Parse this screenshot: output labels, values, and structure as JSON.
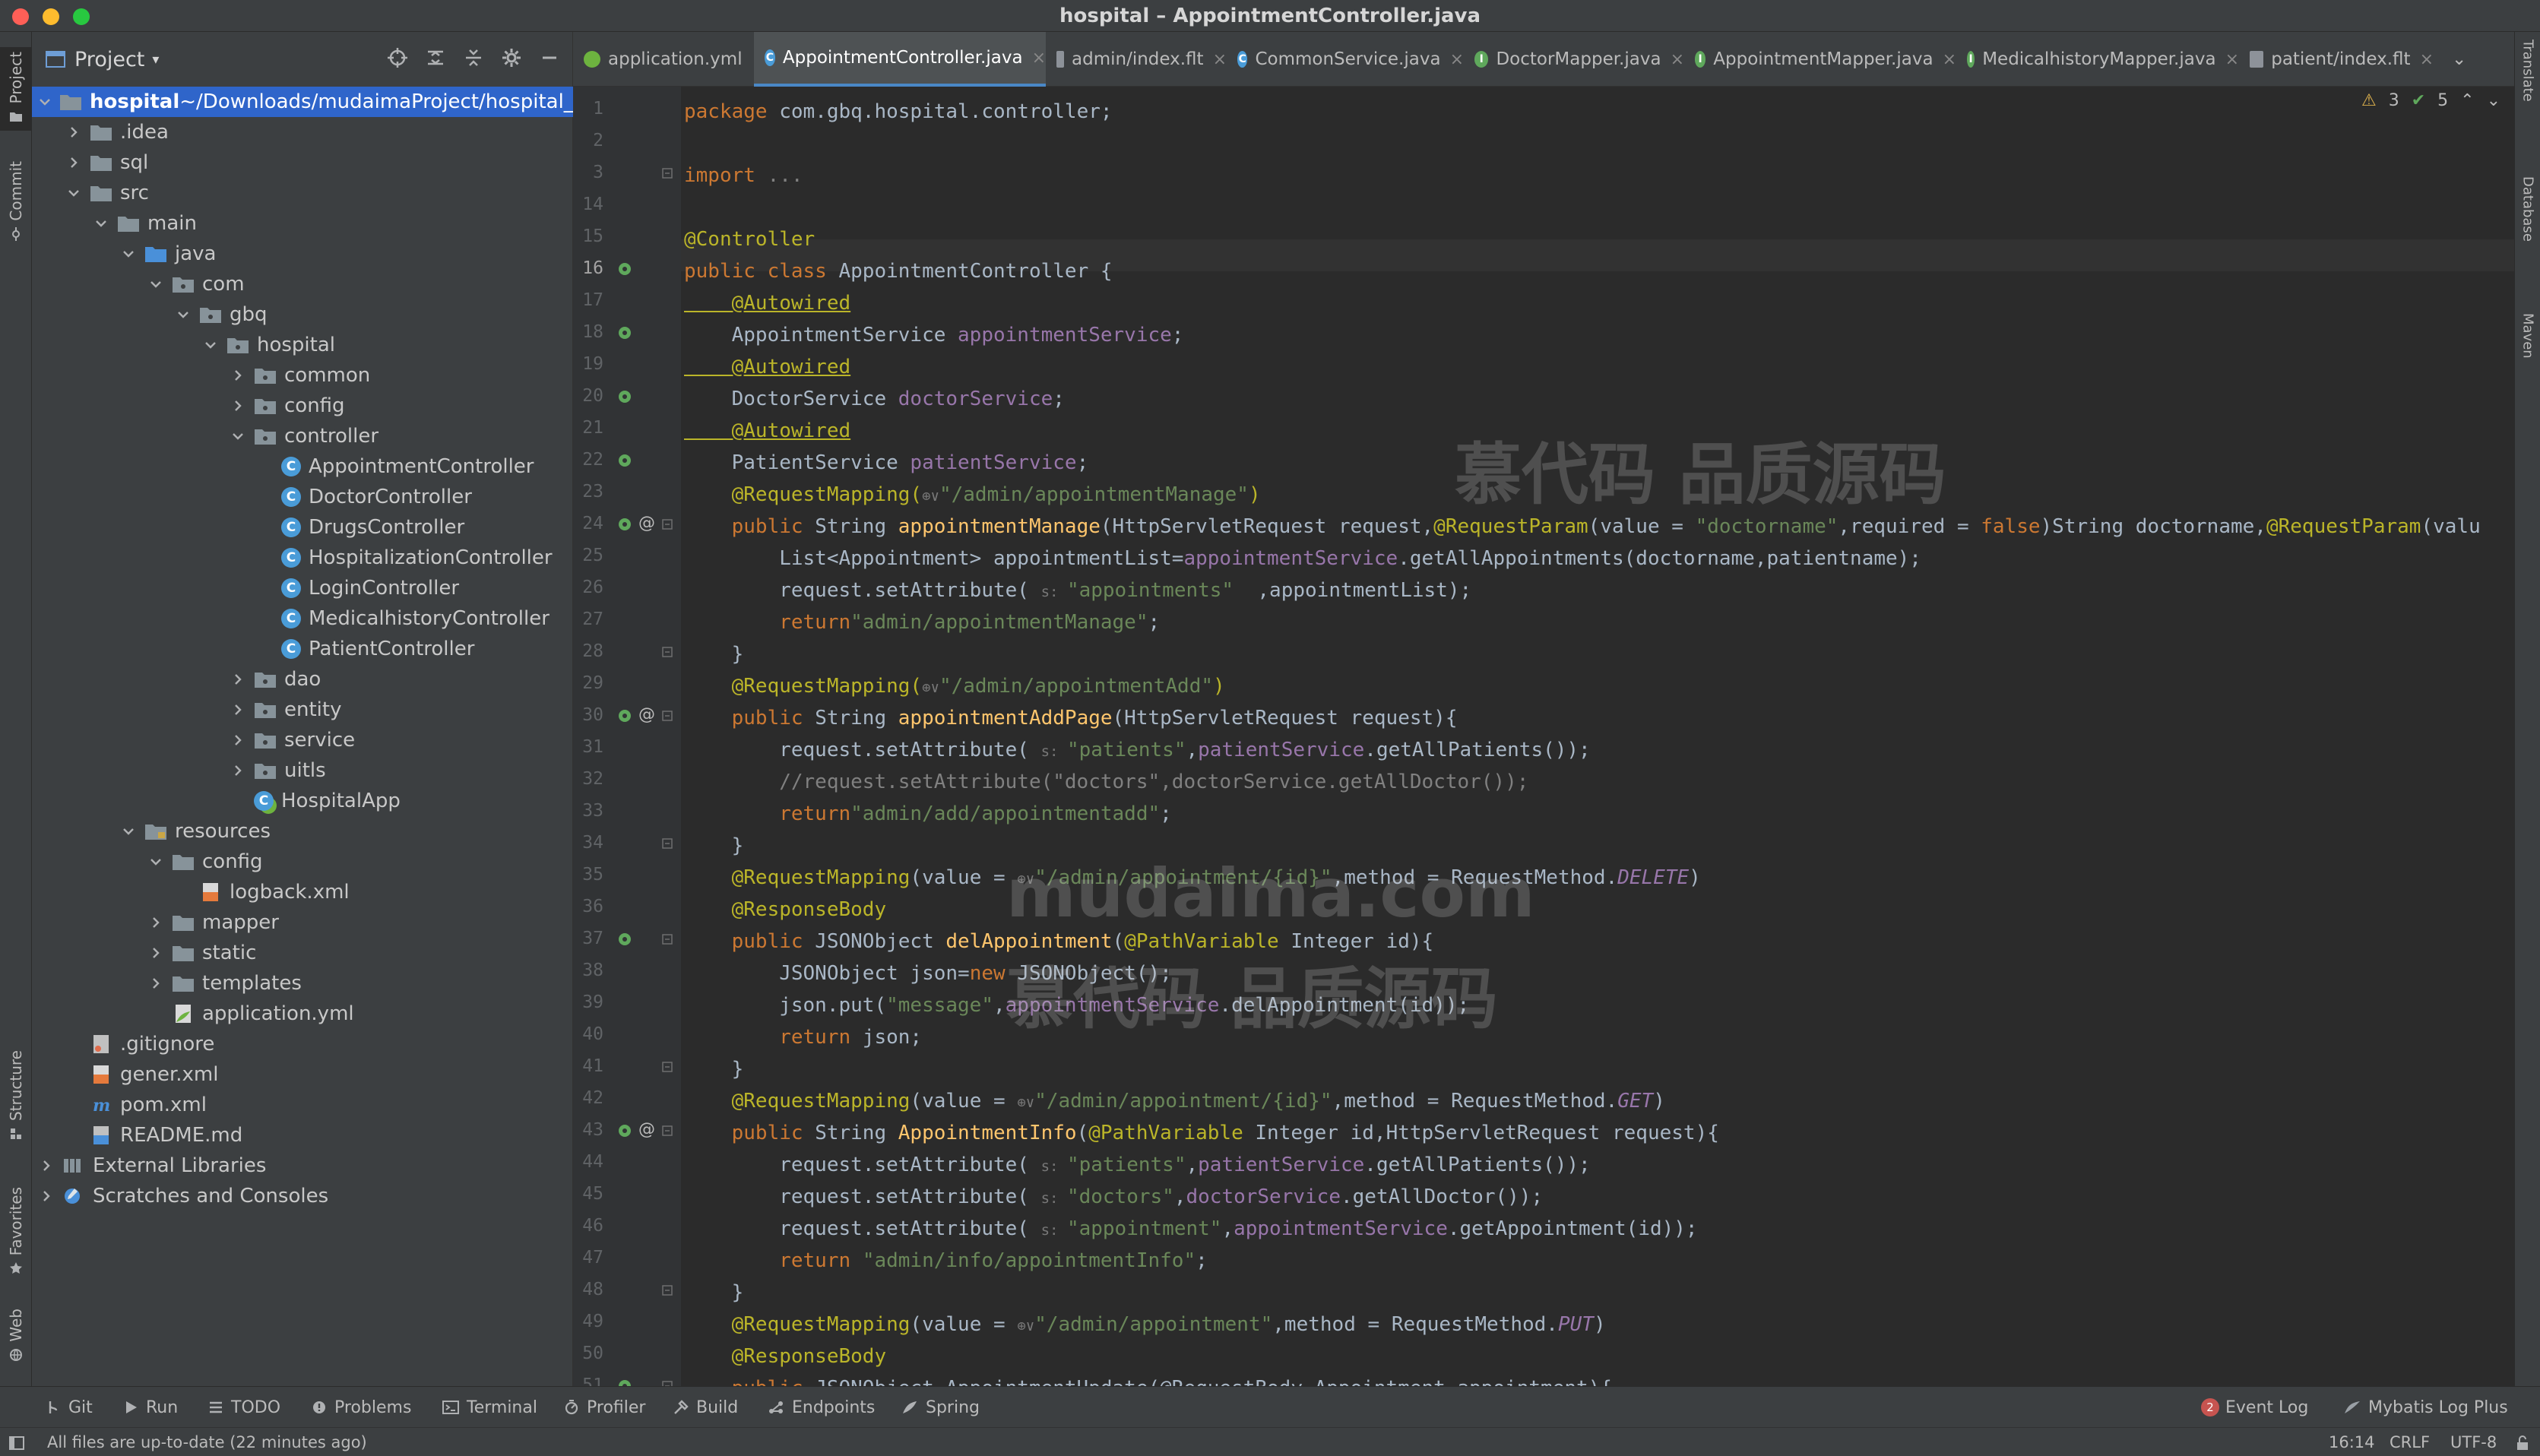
{
  "window": {
    "title": "hospital – AppointmentController.java"
  },
  "colors": {
    "accent": "#2f65ca",
    "keyword": "#cc7832",
    "annotation": "#bbb529",
    "string": "#6a8759",
    "method": "#ffc66d",
    "field": "#9876aa",
    "comment": "#808080"
  },
  "left_strip": {
    "project": "Project",
    "commit": "Commit",
    "structure": "Structure",
    "favorites": "Favorites",
    "web": "Web"
  },
  "right_strip": {
    "translate": "Translate",
    "database": "Database",
    "maven": "Maven"
  },
  "project_panel": {
    "title": "Project",
    "tree": [
      {
        "label": "hospital",
        "extra": " ~/Downloads/mudaimaProject/hospital_n",
        "icon": "folder-icon",
        "depth": 0,
        "state": "open",
        "selected": true
      },
      {
        "label": ".idea",
        "icon": "folder-icon",
        "depth": 1,
        "state": "closed"
      },
      {
        "label": "sql",
        "icon": "folder-icon",
        "depth": 1,
        "state": "closed"
      },
      {
        "label": "src",
        "icon": "folder-icon",
        "depth": 1,
        "state": "open"
      },
      {
        "label": "main",
        "icon": "folder-icon",
        "depth": 2,
        "state": "open"
      },
      {
        "label": "java",
        "icon": "source-folder-icon",
        "depth": 3,
        "state": "open"
      },
      {
        "label": "com",
        "icon": "package-icon",
        "depth": 4,
        "state": "open"
      },
      {
        "label": "gbq",
        "icon": "package-icon",
        "depth": 5,
        "state": "open"
      },
      {
        "label": "hospital",
        "icon": "package-icon",
        "depth": 6,
        "state": "open"
      },
      {
        "label": "common",
        "icon": "package-icon",
        "depth": 7,
        "state": "closed"
      },
      {
        "label": "config",
        "icon": "package-icon",
        "depth": 7,
        "state": "closed"
      },
      {
        "label": "controller",
        "icon": "package-icon",
        "depth": 7,
        "state": "open"
      },
      {
        "label": "AppointmentController",
        "icon": "class-icon",
        "depth": 8,
        "state": "leaf"
      },
      {
        "label": "DoctorController",
        "icon": "class-icon",
        "depth": 8,
        "state": "leaf"
      },
      {
        "label": "DrugsController",
        "icon": "class-icon",
        "depth": 8,
        "state": "leaf"
      },
      {
        "label": "HospitalizationController",
        "icon": "class-icon",
        "depth": 8,
        "state": "leaf"
      },
      {
        "label": "LoginController",
        "icon": "class-icon",
        "depth": 8,
        "state": "leaf"
      },
      {
        "label": "MedicalhistoryController",
        "icon": "class-icon",
        "depth": 8,
        "state": "leaf"
      },
      {
        "label": "PatientController",
        "icon": "class-icon",
        "depth": 8,
        "state": "leaf"
      },
      {
        "label": "dao",
        "icon": "package-icon",
        "depth": 7,
        "state": "closed"
      },
      {
        "label": "entity",
        "icon": "package-icon",
        "depth": 7,
        "state": "closed"
      },
      {
        "label": "service",
        "icon": "package-icon",
        "depth": 7,
        "state": "closed"
      },
      {
        "label": "uitls",
        "icon": "package-icon",
        "depth": 7,
        "state": "closed"
      },
      {
        "label": "HospitalApp",
        "icon": "spring-class-icon",
        "depth": 7,
        "state": "leaf"
      },
      {
        "label": "resources",
        "icon": "resources-folder-icon",
        "depth": 3,
        "state": "open"
      },
      {
        "label": "config",
        "icon": "folder-icon",
        "depth": 4,
        "state": "open"
      },
      {
        "label": "logback.xml",
        "icon": "xml-file-icon",
        "depth": 5,
        "state": "leaf"
      },
      {
        "label": "mapper",
        "icon": "folder-icon",
        "depth": 4,
        "state": "closed"
      },
      {
        "label": "static",
        "icon": "folder-icon",
        "depth": 4,
        "state": "closed"
      },
      {
        "label": "templates",
        "icon": "folder-icon",
        "depth": 4,
        "state": "closed"
      },
      {
        "label": "application.yml",
        "icon": "yaml-file-icon",
        "depth": 4,
        "state": "leaf"
      },
      {
        "label": ".gitignore",
        "icon": "gitignore-file-icon",
        "depth": 1,
        "state": "leaf"
      },
      {
        "label": "gener.xml",
        "icon": "xml-file-icon",
        "depth": 1,
        "state": "leaf"
      },
      {
        "label": "pom.xml",
        "icon": "maven-file-icon",
        "depth": 1,
        "state": "leaf"
      },
      {
        "label": "README.md",
        "icon": "markdown-file-icon",
        "depth": 1,
        "state": "leaf"
      },
      {
        "label": "External Libraries",
        "icon": "library-icon",
        "depth": 0,
        "state": "closed"
      },
      {
        "label": "Scratches and Consoles",
        "icon": "scratches-icon",
        "depth": 0,
        "state": "closed"
      }
    ]
  },
  "tabs": [
    {
      "label": "application.yml",
      "icon": "yaml-file-icon",
      "active": false,
      "closable": false
    },
    {
      "label": "AppointmentController.java",
      "icon": "class-icon",
      "active": true,
      "closable": true
    },
    {
      "label": "admin/index.flt",
      "icon": "file-icon",
      "active": false,
      "closable": true
    },
    {
      "label": "CommonService.java",
      "icon": "class-icon",
      "active": false,
      "closable": true
    },
    {
      "label": "DoctorMapper.java",
      "icon": "interface-icon",
      "active": false,
      "closable": true
    },
    {
      "label": "AppointmentMapper.java",
      "icon": "interface-icon",
      "active": false,
      "closable": true
    },
    {
      "label": "MedicalhistoryMapper.java",
      "icon": "interface-icon",
      "active": false,
      "closable": true
    },
    {
      "label": "patient/index.flt",
      "icon": "file-icon",
      "active": false,
      "closable": true
    }
  ],
  "inspection": {
    "warnings": "3",
    "ok": "5"
  },
  "code_lines": [
    {
      "n": "1",
      "segs": [
        [
          "kw",
          "package "
        ],
        [
          "",
          "com.gbq.hospital.controller;"
        ]
      ]
    },
    {
      "n": "2",
      "segs": []
    },
    {
      "n": "3",
      "segs": [
        [
          "kw",
          "import "
        ],
        [
          "cm",
          "..."
        ]
      ]
    },
    {
      "n": "14",
      "segs": []
    },
    {
      "n": "15",
      "segs": [
        [
          "an",
          "@Controller"
        ]
      ]
    },
    {
      "n": "16",
      "segs": [
        [
          "kw",
          "public class "
        ],
        [
          "",
          "AppointmentController {"
        ]
      ]
    },
    {
      "n": "17",
      "segs": [
        [
          "an ul",
          "    @Autowired"
        ]
      ]
    },
    {
      "n": "18",
      "segs": [
        [
          "",
          "    AppointmentService "
        ],
        [
          "fd",
          "appointmentService"
        ],
        [
          "",
          ";"
        ]
      ]
    },
    {
      "n": "19",
      "segs": [
        [
          "an ul",
          "    @Autowired"
        ]
      ]
    },
    {
      "n": "20",
      "segs": [
        [
          "",
          "    DoctorService "
        ],
        [
          "fd",
          "doctorService"
        ],
        [
          "",
          ";"
        ]
      ]
    },
    {
      "n": "21",
      "segs": [
        [
          "an ul",
          "    @Autowired"
        ]
      ]
    },
    {
      "n": "22",
      "segs": [
        [
          "",
          "    PatientService "
        ],
        [
          "fd",
          "patientService"
        ],
        [
          "",
          ";"
        ]
      ]
    },
    {
      "n": "23",
      "segs": [
        [
          "an",
          "    @RequestMapping("
        ],
        [
          "hint",
          "⊕∨"
        ],
        [
          "st",
          "\"/admin/appointmentManage\""
        ],
        [
          "an",
          ")"
        ]
      ]
    },
    {
      "n": "24",
      "segs": [
        [
          "kw",
          "    public "
        ],
        [
          "",
          "String "
        ],
        [
          "fn",
          "appointmentManage"
        ],
        [
          "",
          "(HttpServletRequest request,"
        ],
        [
          "an",
          "@RequestParam"
        ],
        [
          "",
          "(value = "
        ],
        [
          "st",
          "\"doctorname\""
        ],
        [
          "",
          ",required = "
        ],
        [
          "kw",
          "false"
        ],
        [
          "",
          ")String doctorname,"
        ],
        [
          "an",
          "@RequestParam"
        ],
        [
          "",
          "(valu"
        ]
      ]
    },
    {
      "n": "25",
      "segs": [
        [
          "",
          "        List<Appointment> appointmentList="
        ],
        [
          "fd",
          "appointmentService"
        ],
        [
          "",
          ".getAllAppointments(doctorname,patientname);"
        ]
      ]
    },
    {
      "n": "26",
      "segs": [
        [
          "",
          "        request.setAttribute( "
        ],
        [
          "hint",
          "s: "
        ],
        [
          "st",
          "\"appointments\""
        ],
        [
          "",
          "  ,appointmentList);"
        ]
      ]
    },
    {
      "n": "27",
      "segs": [
        [
          "kw",
          "        return"
        ],
        [
          "st",
          "\"admin/appointmentManage\""
        ],
        [
          "",
          ";"
        ]
      ]
    },
    {
      "n": "28",
      "segs": [
        [
          "",
          "    }"
        ]
      ]
    },
    {
      "n": "29",
      "segs": [
        [
          "an",
          "    @RequestMapping("
        ],
        [
          "hint",
          "⊕∨"
        ],
        [
          "st",
          "\"/admin/appointmentAdd\""
        ],
        [
          "an",
          ")"
        ]
      ]
    },
    {
      "n": "30",
      "segs": [
        [
          "kw",
          "    public "
        ],
        [
          "",
          "String "
        ],
        [
          "fn",
          "appointmentAddPage"
        ],
        [
          "",
          "(HttpServletRequest request){"
        ]
      ]
    },
    {
      "n": "31",
      "segs": [
        [
          "",
          "        request.setAttribute( "
        ],
        [
          "hint",
          "s: "
        ],
        [
          "st",
          "\"patients\""
        ],
        [
          "",
          ","
        ],
        [
          "fd",
          "patientService"
        ],
        [
          "",
          ".getAllPatients());"
        ]
      ]
    },
    {
      "n": "32",
      "segs": [
        [
          "cm",
          "        //request.setAttribute(\"doctors\",doctorService.getAllDoctor());"
        ]
      ]
    },
    {
      "n": "33",
      "segs": [
        [
          "kw",
          "        return"
        ],
        [
          "st",
          "\"admin/add/appointmentadd\""
        ],
        [
          "",
          ";"
        ]
      ]
    },
    {
      "n": "34",
      "segs": [
        [
          "",
          "    }"
        ]
      ]
    },
    {
      "n": "35",
      "segs": [
        [
          "an",
          "    @RequestMapping"
        ],
        [
          "",
          "(value = "
        ],
        [
          "hint",
          "⊕∨"
        ],
        [
          "st",
          "\"/admin/appointment/{id}\""
        ],
        [
          "",
          ",method = RequestMethod."
        ],
        [
          "it",
          "DELETE"
        ],
        [
          "",
          ")"
        ]
      ]
    },
    {
      "n": "36",
      "segs": [
        [
          "an",
          "    @ResponseBody"
        ]
      ]
    },
    {
      "n": "37",
      "segs": [
        [
          "kw",
          "    public "
        ],
        [
          "",
          "JSONObject "
        ],
        [
          "fn",
          "delAppointment"
        ],
        [
          "",
          "("
        ],
        [
          "an",
          "@PathVariable "
        ],
        [
          "",
          "Integer id){"
        ]
      ]
    },
    {
      "n": "38",
      "segs": [
        [
          "",
          "        JSONObject json="
        ],
        [
          "kw",
          "new "
        ],
        [
          "",
          "JSONObject();"
        ]
      ]
    },
    {
      "n": "39",
      "segs": [
        [
          "",
          "        json.put("
        ],
        [
          "st",
          "\"message\""
        ],
        [
          "",
          ","
        ],
        [
          "fd",
          "appointmentService"
        ],
        [
          "",
          ".delAppointment(id));"
        ]
      ]
    },
    {
      "n": "40",
      "segs": [
        [
          "kw",
          "        return "
        ],
        [
          "",
          "json;"
        ]
      ]
    },
    {
      "n": "41",
      "segs": [
        [
          "",
          "    }"
        ]
      ]
    },
    {
      "n": "42",
      "segs": [
        [
          "an",
          "    @RequestMapping"
        ],
        [
          "",
          "(value = "
        ],
        [
          "hint",
          "⊕∨"
        ],
        [
          "st",
          "\"/admin/appointment/{id}\""
        ],
        [
          "",
          ",method = RequestMethod."
        ],
        [
          "it",
          "GET"
        ],
        [
          "",
          ")"
        ]
      ]
    },
    {
      "n": "43",
      "segs": [
        [
          "kw",
          "    public "
        ],
        [
          "",
          "String "
        ],
        [
          "fn",
          "AppointmentInfo"
        ],
        [
          "",
          "("
        ],
        [
          "an",
          "@PathVariable "
        ],
        [
          "",
          "Integer id,HttpServletRequest request){"
        ]
      ]
    },
    {
      "n": "44",
      "segs": [
        [
          "",
          "        request.setAttribute( "
        ],
        [
          "hint",
          "s: "
        ],
        [
          "st",
          "\"patients\""
        ],
        [
          "",
          ","
        ],
        [
          "fd",
          "patientService"
        ],
        [
          "",
          ".getAllPatients());"
        ]
      ]
    },
    {
      "n": "45",
      "segs": [
        [
          "",
          "        request.setAttribute( "
        ],
        [
          "hint",
          "s: "
        ],
        [
          "st",
          "\"doctors\""
        ],
        [
          "",
          ","
        ],
        [
          "fd",
          "doctorService"
        ],
        [
          "",
          ".getAllDoctor());"
        ]
      ]
    },
    {
      "n": "46",
      "segs": [
        [
          "",
          "        request.setAttribute( "
        ],
        [
          "hint",
          "s: "
        ],
        [
          "st",
          "\"appointment\""
        ],
        [
          "",
          ","
        ],
        [
          "fd",
          "appointmentService"
        ],
        [
          "",
          ".getAppointment(id));"
        ]
      ]
    },
    {
      "n": "47",
      "segs": [
        [
          "kw",
          "        return "
        ],
        [
          "st",
          "\"admin/info/appointmentInfo\""
        ],
        [
          "",
          ";"
        ]
      ]
    },
    {
      "n": "48",
      "segs": [
        [
          "",
          "    }"
        ]
      ]
    },
    {
      "n": "49",
      "segs": [
        [
          "an",
          "    @RequestMapping"
        ],
        [
          "",
          "(value = "
        ],
        [
          "hint",
          "⊕∨"
        ],
        [
          "st",
          "\"/admin/appointment\""
        ],
        [
          "",
          ",method = RequestMethod."
        ],
        [
          "it",
          "PUT"
        ],
        [
          "",
          ")"
        ]
      ]
    },
    {
      "n": "50",
      "segs": [
        [
          "an",
          "    @ResponseBody"
        ]
      ]
    },
    {
      "n": "51",
      "segs": [
        [
          "kw",
          "    public "
        ],
        [
          "",
          "JSONObject AppointmentUpdate(@RequestBody Appointment appointment){"
        ]
      ]
    }
  ],
  "watermark": {
    "line1": "慕代码 品质源码",
    "line2": "mudaima.com",
    "line3": "慕代码 品质源码"
  },
  "tool_windows": [
    {
      "label": "Git",
      "icon": "git-icon"
    },
    {
      "label": "Run",
      "icon": "run-icon"
    },
    {
      "label": "TODO",
      "icon": "todo-icon"
    },
    {
      "label": "Problems",
      "icon": "problems-icon"
    },
    {
      "label": "Terminal",
      "icon": "terminal-icon"
    },
    {
      "label": "Profiler",
      "icon": "profiler-icon"
    },
    {
      "label": "Build",
      "icon": "build-icon"
    },
    {
      "label": "Endpoints",
      "icon": "endpoints-icon"
    },
    {
      "label": "Spring",
      "icon": "spring-icon"
    }
  ],
  "tool_windows_right": {
    "event_log": "Event Log",
    "event_count": "2",
    "mybatis": "Mybatis Log Plus"
  },
  "status": {
    "message": "All files are up-to-date (22 minutes ago)",
    "position": "16:14",
    "line_sep": "CRLF",
    "encoding": "UTF-8"
  }
}
